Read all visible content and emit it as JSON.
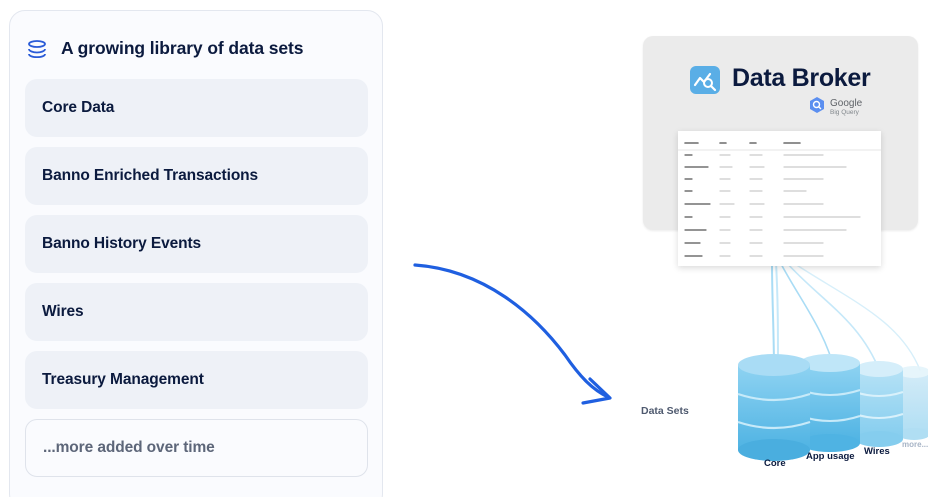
{
  "panel": {
    "title": "A growing library of data sets",
    "title_icon": "database-icon",
    "items": [
      {
        "label": "Core Data"
      },
      {
        "label": "Banno Enriched Transactions"
      },
      {
        "label": "Banno History Events"
      },
      {
        "label": "Wires"
      },
      {
        "label": "Treasury Management"
      },
      {
        "label": "...more added over time"
      }
    ]
  },
  "diagram": {
    "title": "Data Broker",
    "logo_icon": "chart-search-icon",
    "badge_top": "Google",
    "badge_bottom": "Big Query",
    "datasets_label": "Data Sets",
    "databases": {
      "core": "Core",
      "app_usage": "App usage",
      "wires": "Wires",
      "more": "more..."
    }
  },
  "colors": {
    "navy": "#0b1a3e",
    "arrow_blue": "#1f5fe0",
    "db_blue": "#6fc0ea",
    "logo_blue": "#5aaee6"
  }
}
